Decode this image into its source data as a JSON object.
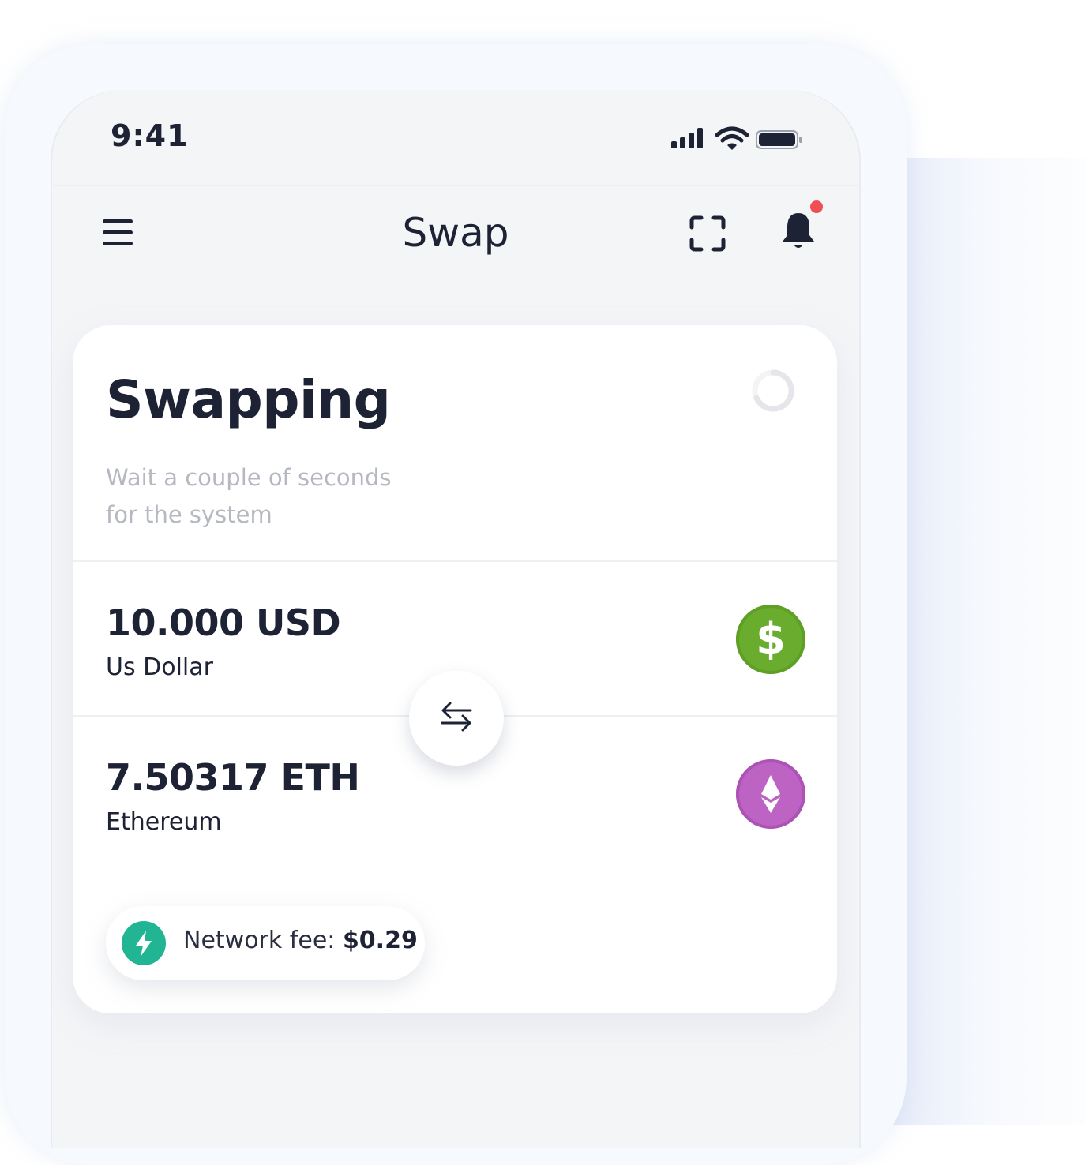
{
  "status_bar": {
    "time": "9:41"
  },
  "nav": {
    "title": "Swap"
  },
  "card": {
    "title": "Swapping",
    "subtitle_line1": "Wait a couple of seconds",
    "subtitle_line2": "for the system",
    "from": {
      "amount": "10.000 USD",
      "name": "Us Dollar",
      "icon": "dollar-coin-icon",
      "color": "#6aad2e"
    },
    "to": {
      "amount": "7.50317 ETH",
      "name": "Ethereum",
      "icon": "ethereum-coin-icon",
      "color": "#bc63c4"
    },
    "fee": {
      "label": "Network fee:",
      "value": "$0.29"
    }
  },
  "colors": {
    "accent_fee": "#22b593",
    "notification_dot": "#ef4e56",
    "text_primary": "#1e2235",
    "text_muted": "#b5b8c0"
  }
}
